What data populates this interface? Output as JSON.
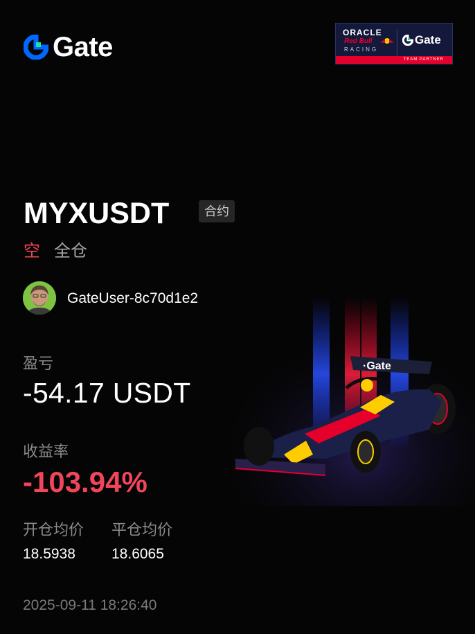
{
  "brand": {
    "name": "Gate"
  },
  "partner_badge": {
    "line1": "ORACLE",
    "line2": "Red Bull",
    "line3": "RACING",
    "brand": "Gate",
    "caption": "TEAM PARTNER"
  },
  "position": {
    "symbol": "MYXUSDT",
    "type_tag": "合约",
    "side": "空",
    "margin_mode": "全仓"
  },
  "user": {
    "name": "GateUser-8c70d1e2"
  },
  "pnl": {
    "label": "盈亏",
    "value": "-54.17 USDT"
  },
  "roi": {
    "label": "收益率",
    "value": "-103.94%"
  },
  "prices": {
    "open_label": "开仓均价",
    "open_value": "18.5938",
    "close_label": "平仓均价",
    "close_value": "18.6065"
  },
  "timestamp": "2025-09-11 18:26:40",
  "car_livery": "·Gate",
  "colors": {
    "background": "#050505",
    "loss_red": "#f0455a",
    "muted_text": "#8a8a8a",
    "brand_blue": "#0068ff",
    "brand_green": "#17e6a1"
  }
}
